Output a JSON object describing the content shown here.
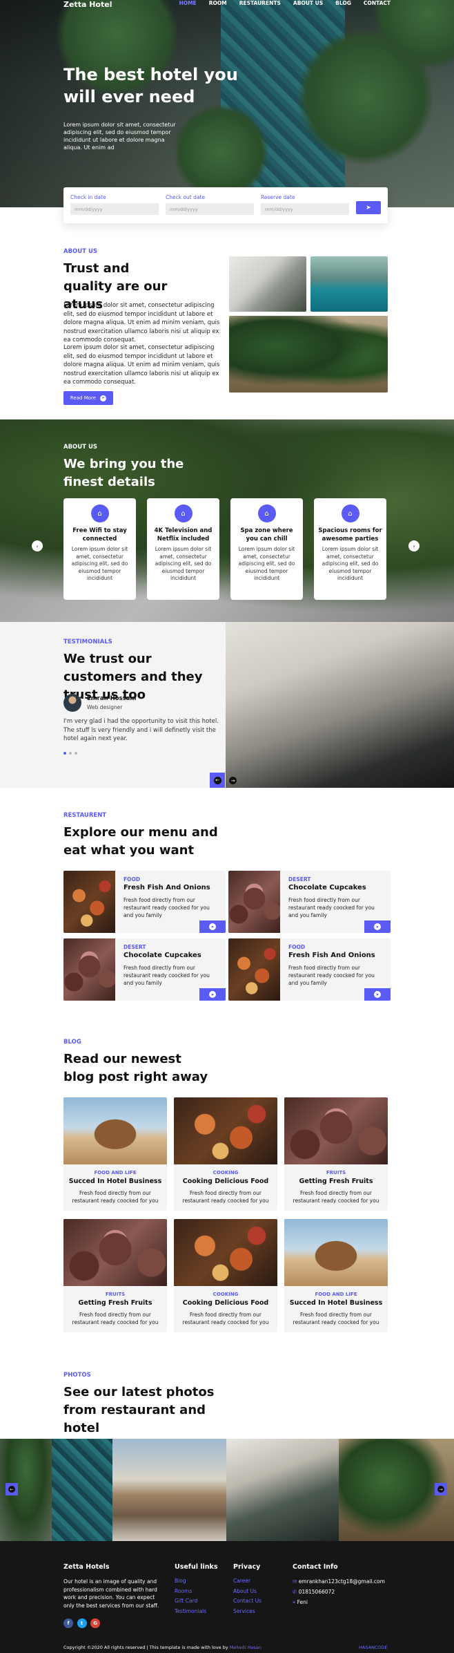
{
  "nav": {
    "logo": "Zetta Hotel",
    "links": [
      "HOME",
      "ROOM",
      "RESTAURENTS",
      "ABOUT US",
      "BLOG",
      "CONTACT"
    ]
  },
  "hero": {
    "title": "The best hotel you will ever need",
    "text": "Lorem ipsum dolor sit amet, consectetur adipiscing elit, sed do eiusmod tempor incididunt ut labore et dolore magna aliqua. Ut enim ad"
  },
  "booking": {
    "checkin_label": "Check in date",
    "checkout_label": "Check out date",
    "reserve_label": "Reserve date",
    "placeholder": "mm/dd/yyyy"
  },
  "about": {
    "kicker": "ABOUT US",
    "title": "Trust and quality are our atuus",
    "para1": "Lorem ipsum dolor sit amet, consectetur adipiscing elit, sed do eiusmod tempor incididunt ut labore et dolore magna aliqua. Ut enim ad minim veniam, quis nostrud exercitation ullamco laboris nisi ut aliquip ex ea commodo consequat.",
    "para2": "Lorem ipsum dolor sit amet, consectetur adipiscing elit, sed do eiusmod tempor incididunt ut labore et dolore magna aliqua. Ut enim ad minim veniam, quis nostrud exercitation ullamco laboris nisi ut aliquip ex ea commodo consequat.",
    "button": "Read More"
  },
  "features": {
    "kicker": "ABOUT US",
    "title": "We bring you the finest details",
    "cards": [
      {
        "title": "Free Wifi to stay connected",
        "text": "Lorem ipsum dolor sit amet, consectetur adipiscing elit, sed do eiusmod tempor incididunt"
      },
      {
        "title": "4K Television and Netflix included",
        "text": "Lorem ipsum dolor sit amet, consectetur adipiscing elit, sed do eiusmod tempor incididunt"
      },
      {
        "title": "Spa zone where you can chill",
        "text": "Lorem ipsum dolor sit amet, consectetur adipiscing elit, sed do eiusmod tempor incididunt"
      },
      {
        "title": "Spacious rooms for awesome parties",
        "text": "Lorem ipsum dolor sit amet, consectetur adipiscing elit, sed do eiusmod tempor incididunt"
      }
    ]
  },
  "testimonials": {
    "kicker": "TESTIMONIALS",
    "title": "We trust our customers and they trust us too",
    "name": "Emran Hossain",
    "role": "Web designer",
    "quote": "I'm very glad i had the opportunity to visit this hotel. The stuff is very friendly and i will definetly visit the hotel again next year."
  },
  "menu": {
    "kicker": "RESTAURENT",
    "title": "Explore our menu and eat what you want",
    "items": [
      {
        "category": "FOOD",
        "title": "Fresh Fish And Onions",
        "desc": "Fresh food directly from our restaurant ready coocked for you and you family"
      },
      {
        "category": "DESERT",
        "title": "Chocolate Cupcakes",
        "desc": "Fresh food directly from our restaurant ready coocked for you and you family"
      },
      {
        "category": "DESERT",
        "title": "Chocolate Cupcakes",
        "desc": "Fresh food directly from our restaurant ready coocked for you and you family"
      },
      {
        "category": "FOOD",
        "title": "Fresh Fish And Onions",
        "desc": "Fresh food directly from our restaurant ready coocked for you and you family"
      }
    ]
  },
  "blog": {
    "kicker": "BLOG",
    "title": "Read our newest blog post right away",
    "posts": [
      {
        "category": "FOOD AND LIFE",
        "title": "Succed In Hotel Business",
        "desc": "Fresh food directly from our restaurant ready coocked for you"
      },
      {
        "category": "COOKING",
        "title": "Cooking Delicious Food",
        "desc": "Fresh food directly from our restaurant ready coocked for you"
      },
      {
        "category": "FRUITS",
        "title": "Getting Fresh Fruits",
        "desc": "Fresh food directly from our restaurant ready coocked for you"
      },
      {
        "category": "FRUITS",
        "title": "Getting Fresh Fruits",
        "desc": "Fresh food directly from our restaurant ready coocked for you"
      },
      {
        "category": "COOKING",
        "title": "Cooking Delicious Food",
        "desc": "Fresh food directly from our restaurant ready coocked for you"
      },
      {
        "category": "FOOD AND LIFE",
        "title": "Succed In Hotel Business",
        "desc": "Fresh food directly from our restaurant ready coocked for you"
      }
    ]
  },
  "photos": {
    "kicker": "PHOTOS",
    "title": "See our latest photos from restaurant and hotel"
  },
  "footer": {
    "brand": "Zetta Hotels",
    "about": "Our hotel is an image of quality and professionalism combined with hard work and precision. You can expect only the best services from our staff.",
    "useful_head": "Useful links",
    "useful": [
      "Blog",
      "Rooms",
      "Gift Card",
      "Testimonials"
    ],
    "privacy_head": "Privacy",
    "privacy": [
      "Career",
      "About Us",
      "Contact Us",
      "Services"
    ],
    "contact_head": "Contact Info",
    "email": "emrankhan123ctg18@gmail.com",
    "phone": "01815066072",
    "city": "Feni",
    "copyright": "Copyright ©2020 All rights reserved | This template is made with love by",
    "author": "Mehedi Hasan",
    "credit": "HASANCODE"
  },
  "colors": {
    "accent": "#5a5af5",
    "footer_bg": "#161616",
    "section_bg": "#f4f4f4"
  }
}
